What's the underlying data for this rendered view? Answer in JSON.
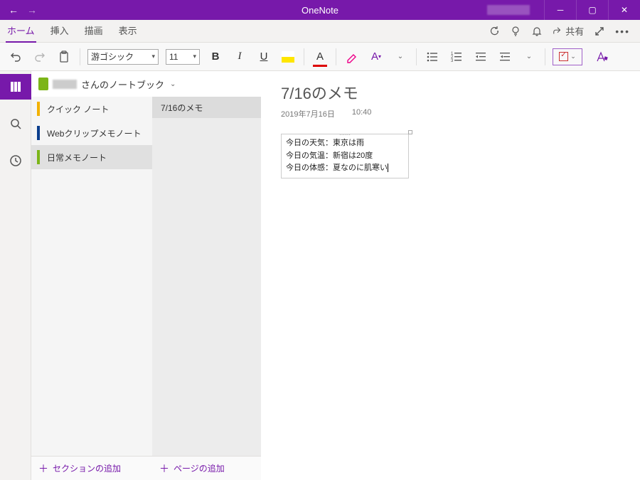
{
  "titlebar": {
    "title": "OneNote"
  },
  "menu": {
    "tabs": [
      "ホーム",
      "挿入",
      "描画",
      "表示"
    ],
    "share": "共有"
  },
  "ribbon": {
    "font_name": "游ゴシック",
    "font_size": "11"
  },
  "notebook": {
    "label_suffix": "さんのノートブック"
  },
  "sections": [
    {
      "label": "クイック ノート",
      "color": "#f2b100"
    },
    {
      "label": "Webクリップメモノート",
      "color": "#0b3e8d"
    },
    {
      "label": "日常メモノート",
      "color": "#7cb518"
    }
  ],
  "pages": [
    {
      "label": "7/16のメモ"
    }
  ],
  "add": {
    "section": "セクションの追加",
    "page": "ページの追加"
  },
  "note": {
    "title": "7/16のメモ",
    "date": "2019年7月16日",
    "time": "10:40",
    "lines": [
      "今日の天気：東京は雨",
      "今日の気温：新宿は20度",
      "今日の体感：夏なのに肌寒い"
    ]
  }
}
